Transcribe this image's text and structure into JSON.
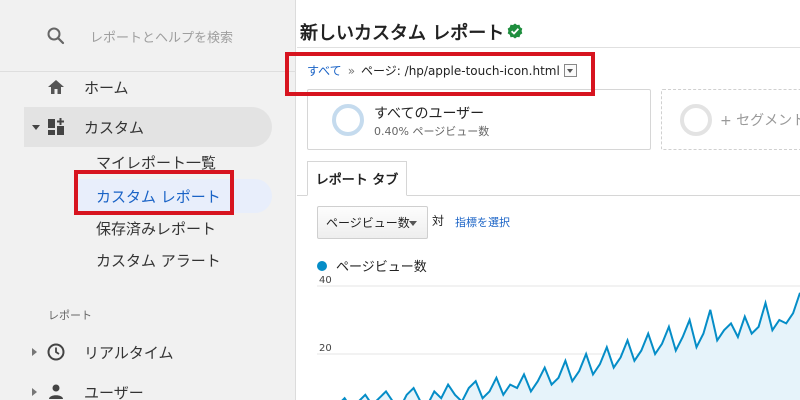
{
  "sidebar": {
    "search_placeholder": "レポートとヘルプを検索",
    "items": [
      {
        "label": "ホーム",
        "icon": "home-icon"
      },
      {
        "label": "カスタム",
        "icon": "dashboard-add-icon"
      }
    ],
    "custom_sub": [
      {
        "label": "マイレポート一覧"
      },
      {
        "label": "カスタム レポート"
      },
      {
        "label": "保存済みレポート"
      },
      {
        "label": "カスタム アラート"
      }
    ],
    "reports_heading": "レポート",
    "report_items": [
      {
        "label": "リアルタイム",
        "icon": "clock-icon"
      },
      {
        "label": "ユーザー",
        "icon": "person-icon"
      }
    ]
  },
  "main": {
    "title": "新しいカスタム レポート",
    "breadcrumb": {
      "all": "すべて",
      "separator": "»",
      "page": "ページ: /hp/apple-touch-icon.html"
    },
    "segment": {
      "name": "すべてのユーザー",
      "detail": "0.40% ページビュー数"
    },
    "add_segment": "+ セグメント",
    "tab": "レポート タブ",
    "metric_select": "ページビュー数",
    "versus": "対",
    "pick_metric": "指標を選択"
  },
  "colors": {
    "accent": "#1a63c6",
    "highlight": "#d7141f",
    "series": "#058dc7"
  },
  "chart_data": {
    "type": "area",
    "series": [
      {
        "name": "ページビュー数",
        "values": [
          4,
          6,
          3,
          5,
          7,
          4,
          6,
          8,
          5,
          7,
          9,
          6,
          4,
          8,
          10,
          6,
          5,
          9,
          7,
          11,
          8,
          6,
          10,
          12,
          7,
          9,
          13,
          8,
          11,
          10,
          14,
          9,
          12,
          16,
          11,
          13,
          18,
          12,
          15,
          20,
          14,
          17,
          22,
          16,
          19,
          24,
          18,
          21,
          26,
          20,
          23,
          28,
          21,
          25,
          30,
          22,
          26,
          33,
          24,
          27,
          29,
          25,
          31,
          26,
          28,
          35,
          27,
          30,
          29,
          32,
          38
        ]
      }
    ],
    "yticks": [
      "40",
      "20"
    ],
    "ylim": [
      0,
      40
    ]
  }
}
